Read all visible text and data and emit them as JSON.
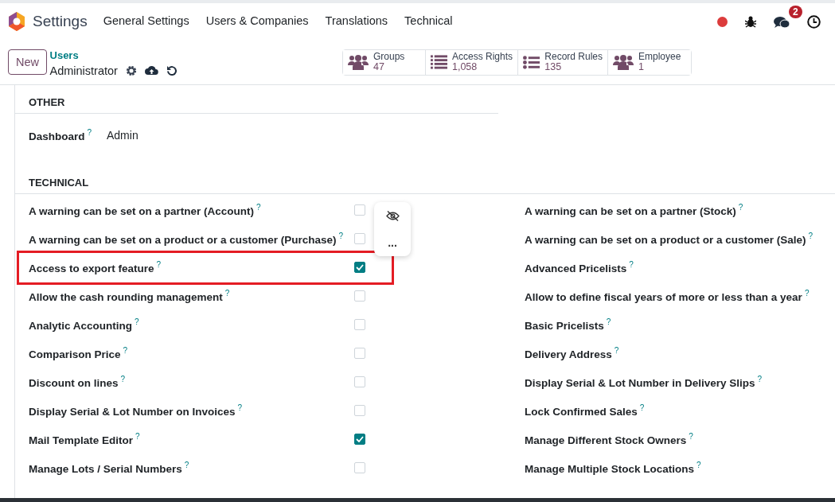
{
  "app": {
    "title": "Settings"
  },
  "menu": [
    {
      "label": "General Settings"
    },
    {
      "label": "Users & Companies"
    },
    {
      "label": "Translations"
    },
    {
      "label": "Technical"
    }
  ],
  "systray": {
    "message_count": "2"
  },
  "control_panel": {
    "new_button": "New",
    "breadcrumb": "Users",
    "record": "Administrator"
  },
  "smart_buttons": [
    {
      "kind": "groups",
      "label": "Groups",
      "value": "47"
    },
    {
      "kind": "list",
      "label": "Access Rights",
      "value": "1,058"
    },
    {
      "kind": "rules",
      "label": "Record Rules",
      "value": "135"
    },
    {
      "kind": "groups",
      "label": "Employee",
      "value": "1"
    }
  ],
  "other": {
    "title": "OTHER",
    "fields": [
      {
        "label": "Dashboard",
        "help": "?",
        "value": "Admin"
      }
    ]
  },
  "technical": {
    "title": "TECHNICAL",
    "left": [
      {
        "label": "A warning can be set on a partner (Account)",
        "help": "?",
        "checked": false
      },
      {
        "label": "A warning can be set on a product or a customer (Purchase)",
        "help": "?",
        "checked": false
      },
      {
        "label": "Access to export feature",
        "help": "?",
        "checked": true,
        "highlighted": true
      },
      {
        "label": "Allow the cash rounding management",
        "help": "?",
        "checked": false
      },
      {
        "label": "Analytic Accounting",
        "help": "?",
        "checked": false
      },
      {
        "label": "Comparison Price",
        "help": "?",
        "checked": false
      },
      {
        "label": "Discount on lines",
        "help": "?",
        "checked": false
      },
      {
        "label": "Display Serial & Lot Number on Invoices",
        "help": "?",
        "checked": false
      },
      {
        "label": "Mail Template Editor",
        "help": "?",
        "checked": true
      },
      {
        "label": "Manage Lots / Serial Numbers",
        "help": "?",
        "checked": false
      }
    ],
    "right": [
      {
        "label": "A warning can be set on a partner (Stock)",
        "help": "?"
      },
      {
        "label": "A warning can be set on a product or a customer (Sale)",
        "help": "?"
      },
      {
        "label": "Advanced Pricelists",
        "help": "?"
      },
      {
        "label": "Allow to define fiscal years of more or less than a year",
        "help": "?"
      },
      {
        "label": "Basic Pricelists",
        "help": "?"
      },
      {
        "label": "Delivery Address",
        "help": "?"
      },
      {
        "label": "Display Serial & Lot Number in Delivery Slips",
        "help": "?"
      },
      {
        "label": "Lock Confirmed Sales",
        "help": "?"
      },
      {
        "label": "Manage Different Stock Owners",
        "help": "?"
      },
      {
        "label": "Manage Multiple Stock Locations",
        "help": "?"
      }
    ]
  },
  "row_popup": {
    "more": "..."
  }
}
